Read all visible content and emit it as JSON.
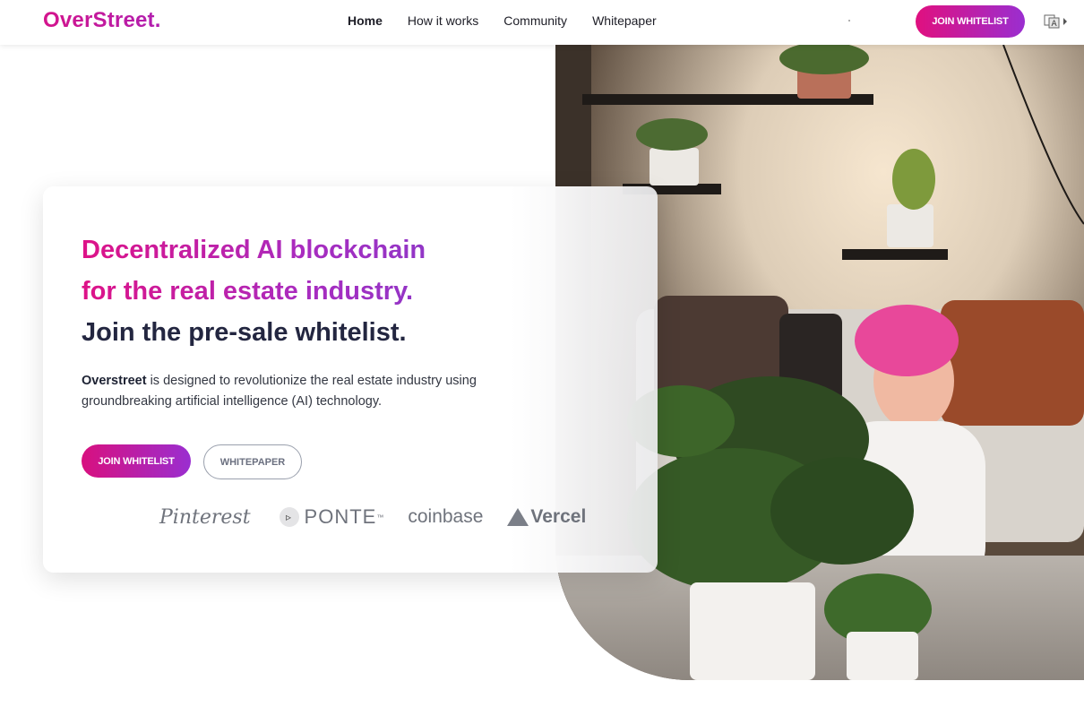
{
  "header": {
    "logo": "OverStreet.",
    "nav": [
      "Home",
      "How it works",
      "Community",
      "Whitepaper"
    ],
    "cta": "JOIN WHITELIST",
    "language_icon": "translate-icon"
  },
  "hero": {
    "headline_line1": "Decentralized AI blockchain",
    "headline_line2": "for the real estate industry.",
    "headline_line3": "Join the pre-sale whitelist.",
    "description_bold": "Overstreet",
    "description_rest": " is designed to revolutionize the real estate industry using groundbreaking artificial intelligence (AI) technology.",
    "primary_button": "JOIN WHITELIST",
    "secondary_button": "WHITEPAPER",
    "partners": [
      "Pinterest",
      "PONTE",
      "™",
      "coinbase",
      "Vercel"
    ]
  },
  "colors": {
    "brand_pink": "#de1287",
    "brand_purple": "#9a2ed0",
    "dark_text": "#232640"
  }
}
